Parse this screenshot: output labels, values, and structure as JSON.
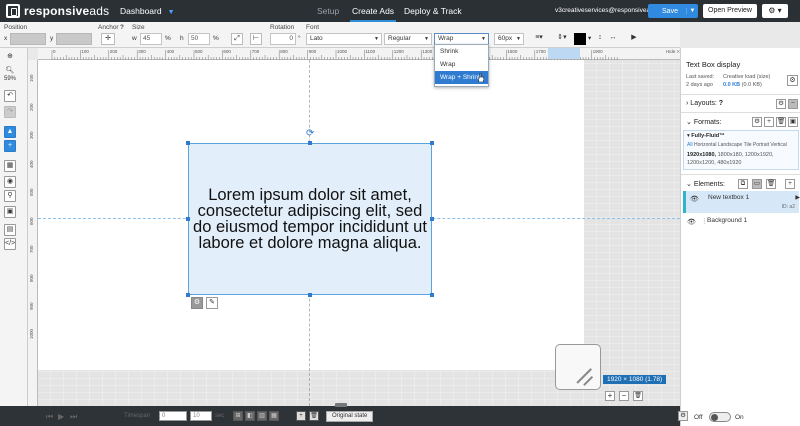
{
  "app": {
    "logo_bold": "responsive",
    "logo_light": "ads",
    "nav_dashboard": "Dashboard",
    "tabs": {
      "setup": "Setup",
      "create": "Create Ads",
      "deploy": "Deploy & Track"
    },
    "account": "v3creativeservices@responsivea...",
    "save_label": "Save",
    "preview_label": "Open Preview",
    "gear_glyph": "⚙ ▾",
    "accent": "#2f8ae0"
  },
  "propbar": {
    "position_label": "Position",
    "x_label": "x",
    "y_label": "y",
    "anchor_label": "Anchor",
    "help_glyph": "?",
    "size_label": "Size",
    "w_label": "w",
    "w_value": "45",
    "pct": "%",
    "h_label": "h",
    "h_value": "50",
    "rotation_label": "Rotation",
    "rotation_value": "0",
    "degree": "°",
    "font_label": "Font",
    "font_value": "Lato",
    "weight_value": "Regular",
    "fit_value": "Wrap",
    "size_value": "60px"
  },
  "fit_dropdown": {
    "options": [
      "Shrink",
      "Wrap",
      "Wrap + Shrink"
    ],
    "selected_index": 2
  },
  "rulers": {
    "top_ticks": [
      "0",
      "100",
      "200",
      "300",
      "400",
      "500",
      "600",
      "700",
      "800",
      "900",
      "1000",
      "1100",
      "1200",
      "1300",
      "1400",
      "1500",
      "1600",
      "1700",
      "1800",
      "1900"
    ],
    "left_ticks": [
      "100",
      "200",
      "300",
      "400",
      "500",
      "600",
      "700",
      "800",
      "900",
      "1000"
    ],
    "hide_link": "Hide >>"
  },
  "tools": {
    "zoom": "59%"
  },
  "canvas": {
    "text": "Lorem ipsum dolor sit amet, consectetur adipiscing elit, sed do eiusmod tempor incididunt ut labore et dolore magna aliqua.",
    "resolution": "1920 × 1080  (1.78)"
  },
  "timeline": {
    "timespan_label": "Timespan",
    "timespan_value": "0",
    "duration_value": "10",
    "sec_label": "sec",
    "original_state": "Original state",
    "off_label": "Off",
    "on_label": "On"
  },
  "panel": {
    "title": "Text Box display",
    "last_saved_label": "Last saved:",
    "last_saved_value": "2 days ago",
    "load_label": "Creative load (size)",
    "load_value": "0.0 KB",
    "load_detail": "(0.0 KB)",
    "layouts_label": "Layouts:",
    "formats_label": "Formats:",
    "format_name": "Fully-Fluid™",
    "format_all": "All",
    "format_orientations": "Horizontal Landscape Tile Portrait Vertical",
    "format_sizes_bold": "1920x1080,",
    "format_sizes_1": "1800x180, 1200x1920,",
    "format_sizes_2": "1200x1200, 480x1920",
    "elements_label": "Elements:",
    "elements": [
      {
        "name": "New textbox 1",
        "id": "ID: a2"
      },
      {
        "name": "Background 1",
        "id": ""
      }
    ]
  }
}
